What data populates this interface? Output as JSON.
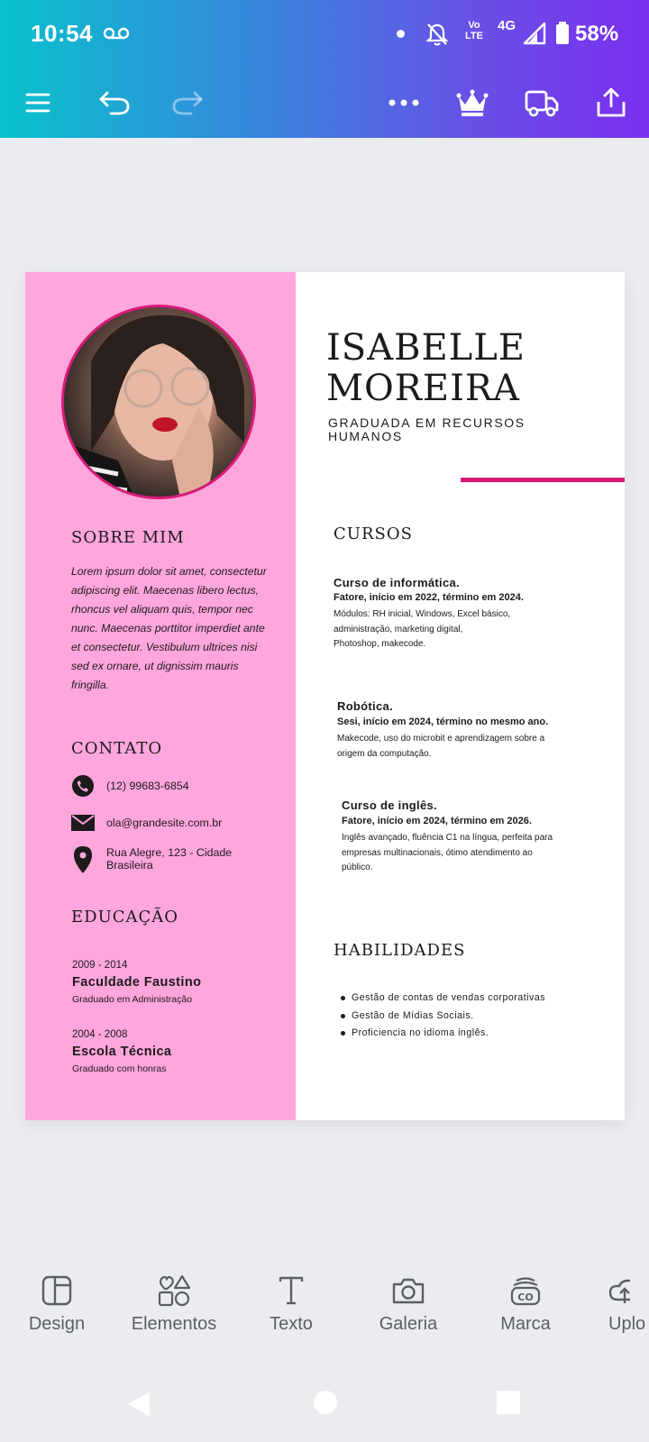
{
  "status_bar": {
    "time": "10:54",
    "volte_line1": "Vo",
    "volte_line2": "LTE",
    "network": "4G",
    "battery": "58%"
  },
  "toolbar": {
    "menu_icon": "hamburger-menu-icon",
    "undo_icon": "undo-icon",
    "redo_icon": "redo-icon",
    "more_icon": "more-horizontal-icon",
    "premium_icon": "crown-icon",
    "print_icon": "delivery-truck-icon",
    "share_icon": "share-upload-icon"
  },
  "resume": {
    "name_line1": "ISABELLE",
    "name_line2": "MOREIRA",
    "subtitle": "GRADUADA EM RECURSOS HUMANOS",
    "accent_color": "#d81b7a",
    "sidebar_color": "#ffa6dc",
    "about": {
      "title": "SOBRE MIM",
      "text": "Lorem ipsum dolor sit amet, consectetur adipiscing elit. Maecenas libero lectus, rhoncus vel aliquam quis, tempor nec nunc. Maecenas porttitor imperdiet ante et consectetur. Vestibulum ultrices nisi sed ex ornare, ut dignissim mauris fringilla."
    },
    "contact": {
      "title": "CONTATO",
      "phone": "(12) 99683-6854",
      "email": "ola@grandesite.com.br",
      "address_line1": "Rua Alegre, 123 - Cidade",
      "address_line2": "Brasileira"
    },
    "education": {
      "title": "EDUCAÇÃO",
      "items": [
        {
          "years": "2009 - 2014",
          "name": "Faculdade Faustino",
          "desc": "Graduado em Administração"
        },
        {
          "years": "2004 - 2008",
          "name": "Escola Técnica",
          "desc": "Graduado com honras"
        }
      ]
    },
    "courses": {
      "title": "CURSOS",
      "items": [
        {
          "title": "Curso de informática.",
          "sub": "Fatore, início em 2022, término em 2024.",
          "desc1": "Módulos: RH inicial, Windows, Excel básico,",
          "desc2": "administração, marketing digital,",
          "desc3": "Photoshop, makecode."
        },
        {
          "title": "Robótica.",
          "sub": "Sesi, início em 2024, término no mesmo ano.",
          "desc1": "Makecode, uso do microbit e aprendizagem sobre a",
          "desc2": "origem da computação."
        },
        {
          "title": "Curso de inglês.",
          "sub": "Fatore, início em 2024, término em 2026.",
          "desc1": "Inglês avançado, fluência C1 na língua, perfeita para",
          "desc2": "empresas multinacionais, ótimo atendimento ao",
          "desc3": "público."
        }
      ]
    },
    "skills": {
      "title": "HABILIDADES",
      "items": [
        "Gestão de contas de vendas corporativas",
        "Gestão de Mídias Sociais.",
        "Proficiencia no idioma inglês."
      ]
    }
  },
  "bottom_tools": [
    {
      "label": "Design",
      "icon": "layout-icon"
    },
    {
      "label": "Elementos",
      "icon": "shapes-icon"
    },
    {
      "label": "Texto",
      "icon": "text-icon"
    },
    {
      "label": "Galeria",
      "icon": "camera-icon"
    },
    {
      "label": "Marca",
      "icon": "brand-icon"
    },
    {
      "label": "Uplo",
      "icon": "cloud-upload-icon"
    }
  ]
}
